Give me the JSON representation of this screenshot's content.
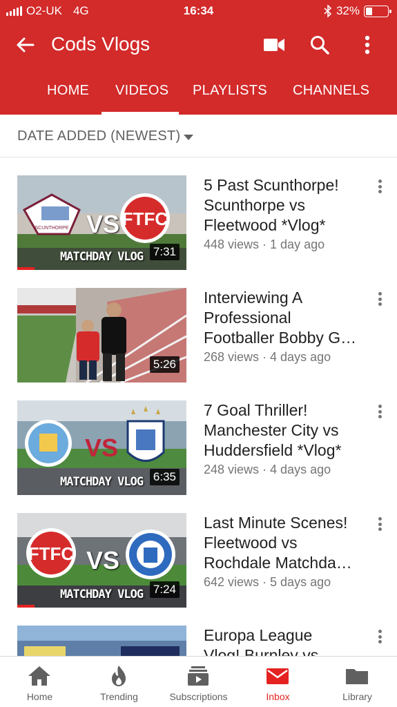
{
  "status": {
    "carrier": "O2-UK",
    "network": "4G",
    "time": "16:34",
    "battery": "32%",
    "battery_level": 0.32
  },
  "header": {
    "title": "Cods Vlogs",
    "icons": [
      "back-arrow-icon",
      "video-camera-icon",
      "search-icon",
      "more-vert-icon"
    ]
  },
  "tabs": [
    {
      "label": "HOME"
    },
    {
      "label": "VIDEOS"
    },
    {
      "label": "PLAYLISTS"
    },
    {
      "label": "CHANNELS"
    }
  ],
  "sort": {
    "label": "DATE ADDED (NEWEST)"
  },
  "videos": [
    {
      "title_lines": [
        "5 Past Scunthorpe!",
        "Scunthorpe vs",
        "Fleetwood *Vlog*"
      ],
      "meta": "448 views · 1 day ago",
      "duration": "7:31",
      "thumb_text": "MATCHDAY VLOG",
      "thumb_vs": "VS",
      "watched": 0.1
    },
    {
      "title_lines": [
        "Interviewing A",
        "Professional",
        "Footballer Bobby G…"
      ],
      "meta": "268 views · 4 days ago",
      "duration": "5:26",
      "thumb_text": "",
      "thumb_vs": "",
      "watched": 0
    },
    {
      "title_lines": [
        "7 Goal Thriller!",
        "Manchester City vs",
        "Huddersfield *Vlog*"
      ],
      "meta": "248 views · 4 days ago",
      "duration": "6:35",
      "thumb_text": "MATCHDAY VLOG",
      "thumb_vs": "VS",
      "watched": 0
    },
    {
      "title_lines": [
        "Last Minute Scenes!",
        "Fleetwood vs",
        "Rochdale Matchda…"
      ],
      "meta": "642 views · 5 days ago",
      "duration": "7:24",
      "thumb_text": "MATCHDAY VLOG",
      "thumb_vs": "VS",
      "watched": 0.1
    },
    {
      "title_lines": [
        "Europa League",
        "Vlog! Burnley vs"
      ],
      "meta": "",
      "duration": "",
      "thumb_text": "",
      "thumb_vs": "",
      "watched": 0
    }
  ],
  "bottom_nav": [
    {
      "label": "Home",
      "icon": "home-icon"
    },
    {
      "label": "Trending",
      "icon": "flame-icon"
    },
    {
      "label": "Subscriptions",
      "icon": "subscriptions-icon"
    },
    {
      "label": "Inbox",
      "icon": "inbox-icon",
      "active": true
    },
    {
      "label": "Library",
      "icon": "folder-icon"
    }
  ],
  "colors": {
    "brand": "#d32a2a",
    "accent": "#e52222",
    "text_secondary": "#757575"
  }
}
